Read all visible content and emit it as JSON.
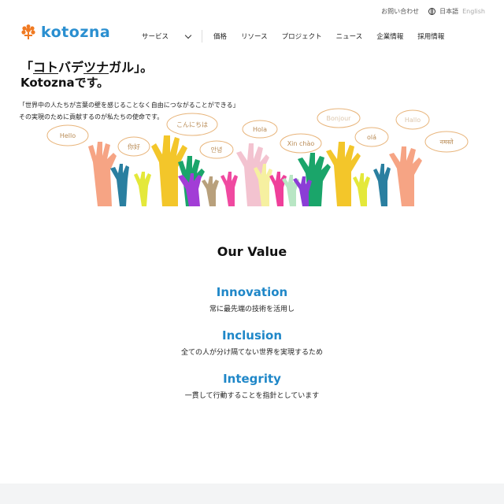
{
  "utility": {
    "contact": "お問い合わせ",
    "lang_ja": "日本語",
    "lang_en": "English"
  },
  "logo": {
    "text": "kotozna"
  },
  "nav": {
    "items": [
      {
        "label": "サービス"
      },
      {
        "label": "価格"
      },
      {
        "label": "リソース"
      },
      {
        "label": "プロジェクト"
      },
      {
        "label": "ニュース"
      },
      {
        "label": "企業情報"
      },
      {
        "label": "採用情報"
      }
    ]
  },
  "hero": {
    "line1_open": "「",
    "line1_a": "コト",
    "line1_b": "バデ",
    "line1_c": "ツナ",
    "line1_d": "ガル」。",
    "line2": "Kotoznaです。",
    "body1": "「世界中の人たちが言葉の壁を感じることなく自由につながることができる」",
    "body2": "その実現のために貢献するのが私たちの使命です。",
    "bubbles": [
      "Hello",
      "你好",
      "こんにちは",
      "안녕",
      "Hola",
      "Xin chào",
      "Bonjour",
      "olá",
      "Hallo",
      "नमस्ते"
    ]
  },
  "values": {
    "title": "Our Value",
    "items": [
      {
        "heading": "Innovation",
        "desc": "常に最先端の技術を活用し"
      },
      {
        "heading": "Inclusion",
        "desc": "全ての人が分け隔てない世界を実現するため"
      },
      {
        "heading": "Integrity",
        "desc": "一貫して行動することを指針としています"
      }
    ]
  },
  "colors": {
    "brand": "#1f87c8",
    "logo_orange": "#f07a22"
  }
}
